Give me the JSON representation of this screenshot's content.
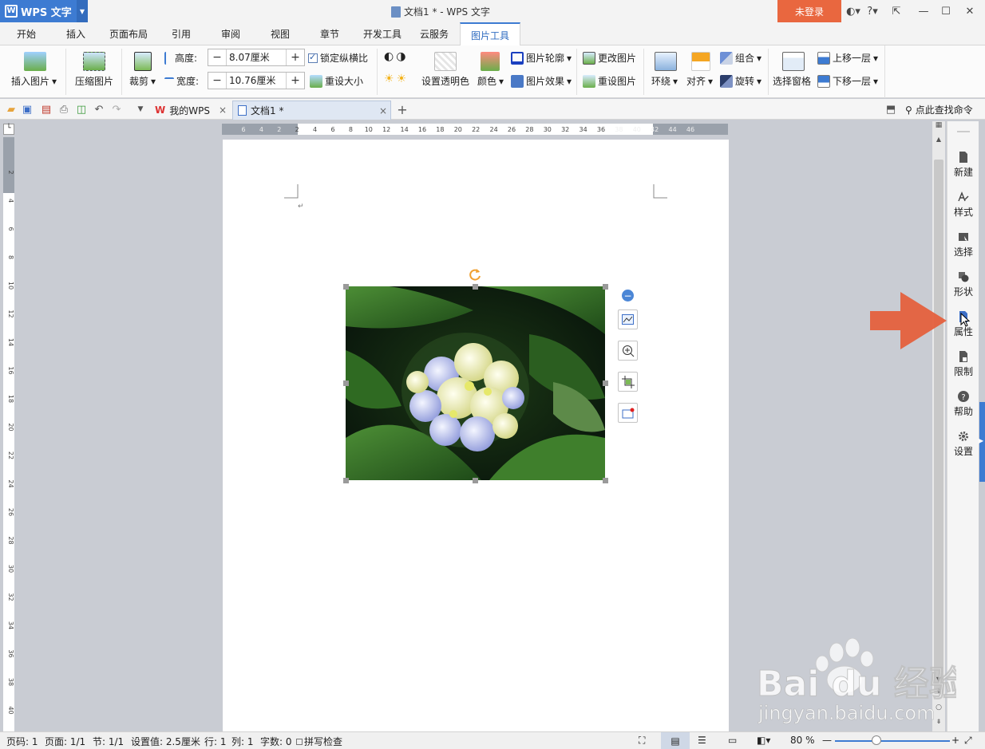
{
  "title_bar": {
    "app_name": "WPS 文字",
    "document_title": "文档1 * - WPS 文字",
    "login_label": "未登录",
    "help_label": "?"
  },
  "ribbon_tabs": [
    {
      "label": "开始"
    },
    {
      "label": "插入"
    },
    {
      "label": "页面布局"
    },
    {
      "label": "引用"
    },
    {
      "label": "审阅"
    },
    {
      "label": "视图"
    },
    {
      "label": "章节"
    },
    {
      "label": "开发工具"
    },
    {
      "label": "云服务"
    },
    {
      "label": "图片工具"
    }
  ],
  "active_tab": "图片工具",
  "ribbon": {
    "insert_picture": "插入图片",
    "compress_picture": "压缩图片",
    "crop": "裁剪",
    "height_label": "高度:",
    "height_value": "8.07厘米",
    "width_label": "宽度:",
    "width_value": "10.76厘米",
    "lock_ratio": "锁定纵横比",
    "reset_size": "重设大小",
    "set_transparent": "设置透明色",
    "color": "颜色",
    "picture_outline": "图片轮廓",
    "picture_effects": "图片效果",
    "change_picture": "更改图片",
    "reset_picture": "重设图片",
    "wrap": "环绕",
    "align": "对齐",
    "group": "组合",
    "rotate": "旋转",
    "selection_pane": "选择窗格",
    "bring_forward": "上移一层",
    "send_backward": "下移一层"
  },
  "quick_bar": {
    "doc_tabs": [
      {
        "label": "我的WPS"
      },
      {
        "label": "文档1 *"
      }
    ],
    "add_tab": "+",
    "search_command": "点此查找命令"
  },
  "ruler": {
    "h_ticks": [
      "6",
      "4",
      "2",
      "2",
      "4",
      "6",
      "8",
      "10",
      "12",
      "14",
      "16",
      "18",
      "20",
      "22",
      "24",
      "26",
      "28",
      "30",
      "32",
      "34",
      "36",
      "38",
      "40",
      "42",
      "44",
      "46"
    ],
    "v_ticks": [
      "2",
      "4",
      "6",
      "8",
      "10",
      "12",
      "14",
      "16",
      "18",
      "20",
      "22",
      "24",
      "26",
      "28",
      "30",
      "32",
      "34",
      "36",
      "38",
      "40"
    ]
  },
  "side_panel": {
    "items": [
      {
        "label": "新建"
      },
      {
        "label": "样式"
      },
      {
        "label": "选择"
      },
      {
        "label": "形状"
      },
      {
        "label": "属性"
      },
      {
        "label": "限制"
      },
      {
        "label": "帮助"
      },
      {
        "label": "设置"
      }
    ]
  },
  "status_bar": {
    "page_code": "页码: 1",
    "page": "页面: 1/1",
    "section": "节: 1/1",
    "setting": "设置值: 2.5厘米",
    "row": "行: 1",
    "col": "列: 1",
    "word_count": "字数: 0",
    "spell_check": "拼写检查",
    "zoom": "80 %"
  },
  "watermark": {
    "brand": "Bai du 经验",
    "url": "jingyan.baidu.com"
  },
  "colors": {
    "accent_blue": "#3d7bd2",
    "login_orange": "#e9673f",
    "arrow_orange": "#e5603d"
  }
}
